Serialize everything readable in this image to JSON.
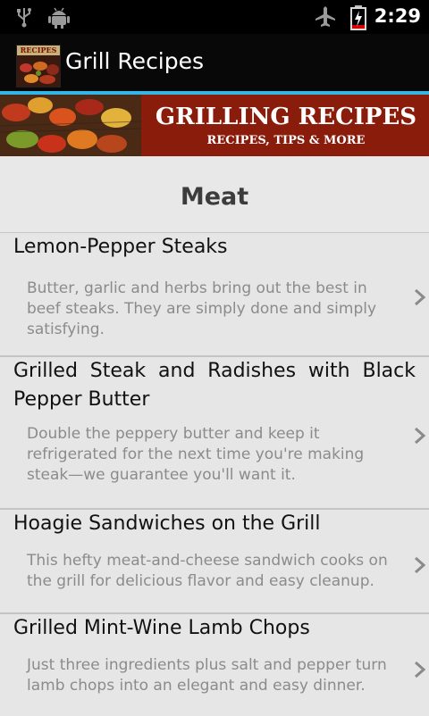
{
  "status_bar": {
    "time": "2:29"
  },
  "title_bar": {
    "title": "Grill Recipes",
    "icon_label": "RECIPES"
  },
  "banner": {
    "title": "GRILLING RECIPES",
    "subtitle": "RECIPES, TIPS & MORE"
  },
  "section": {
    "title": "Meat"
  },
  "recipes": [
    {
      "title": "Lemon-Pepper Steaks",
      "description": "Butter, garlic and herbs bring out the best in beef steaks. They are simply done and simply satisfying."
    },
    {
      "title": "Grilled Steak and Radishes with Black Pepper Butter",
      "description": "Double the peppery butter and keep it refrigerated for the next time you're making steak—we guarantee you'll want it."
    },
    {
      "title": "Hoagie Sandwiches on the Grill",
      "description": "This hefty meat-and-cheese sandwich cooks on the grill for delicious flavor and easy cleanup."
    },
    {
      "title": "Grilled Mint-Wine Lamb Chops",
      "description": "Just three ingredients plus salt and pepper turn lamb chops into an elegant and easy dinner."
    }
  ]
}
